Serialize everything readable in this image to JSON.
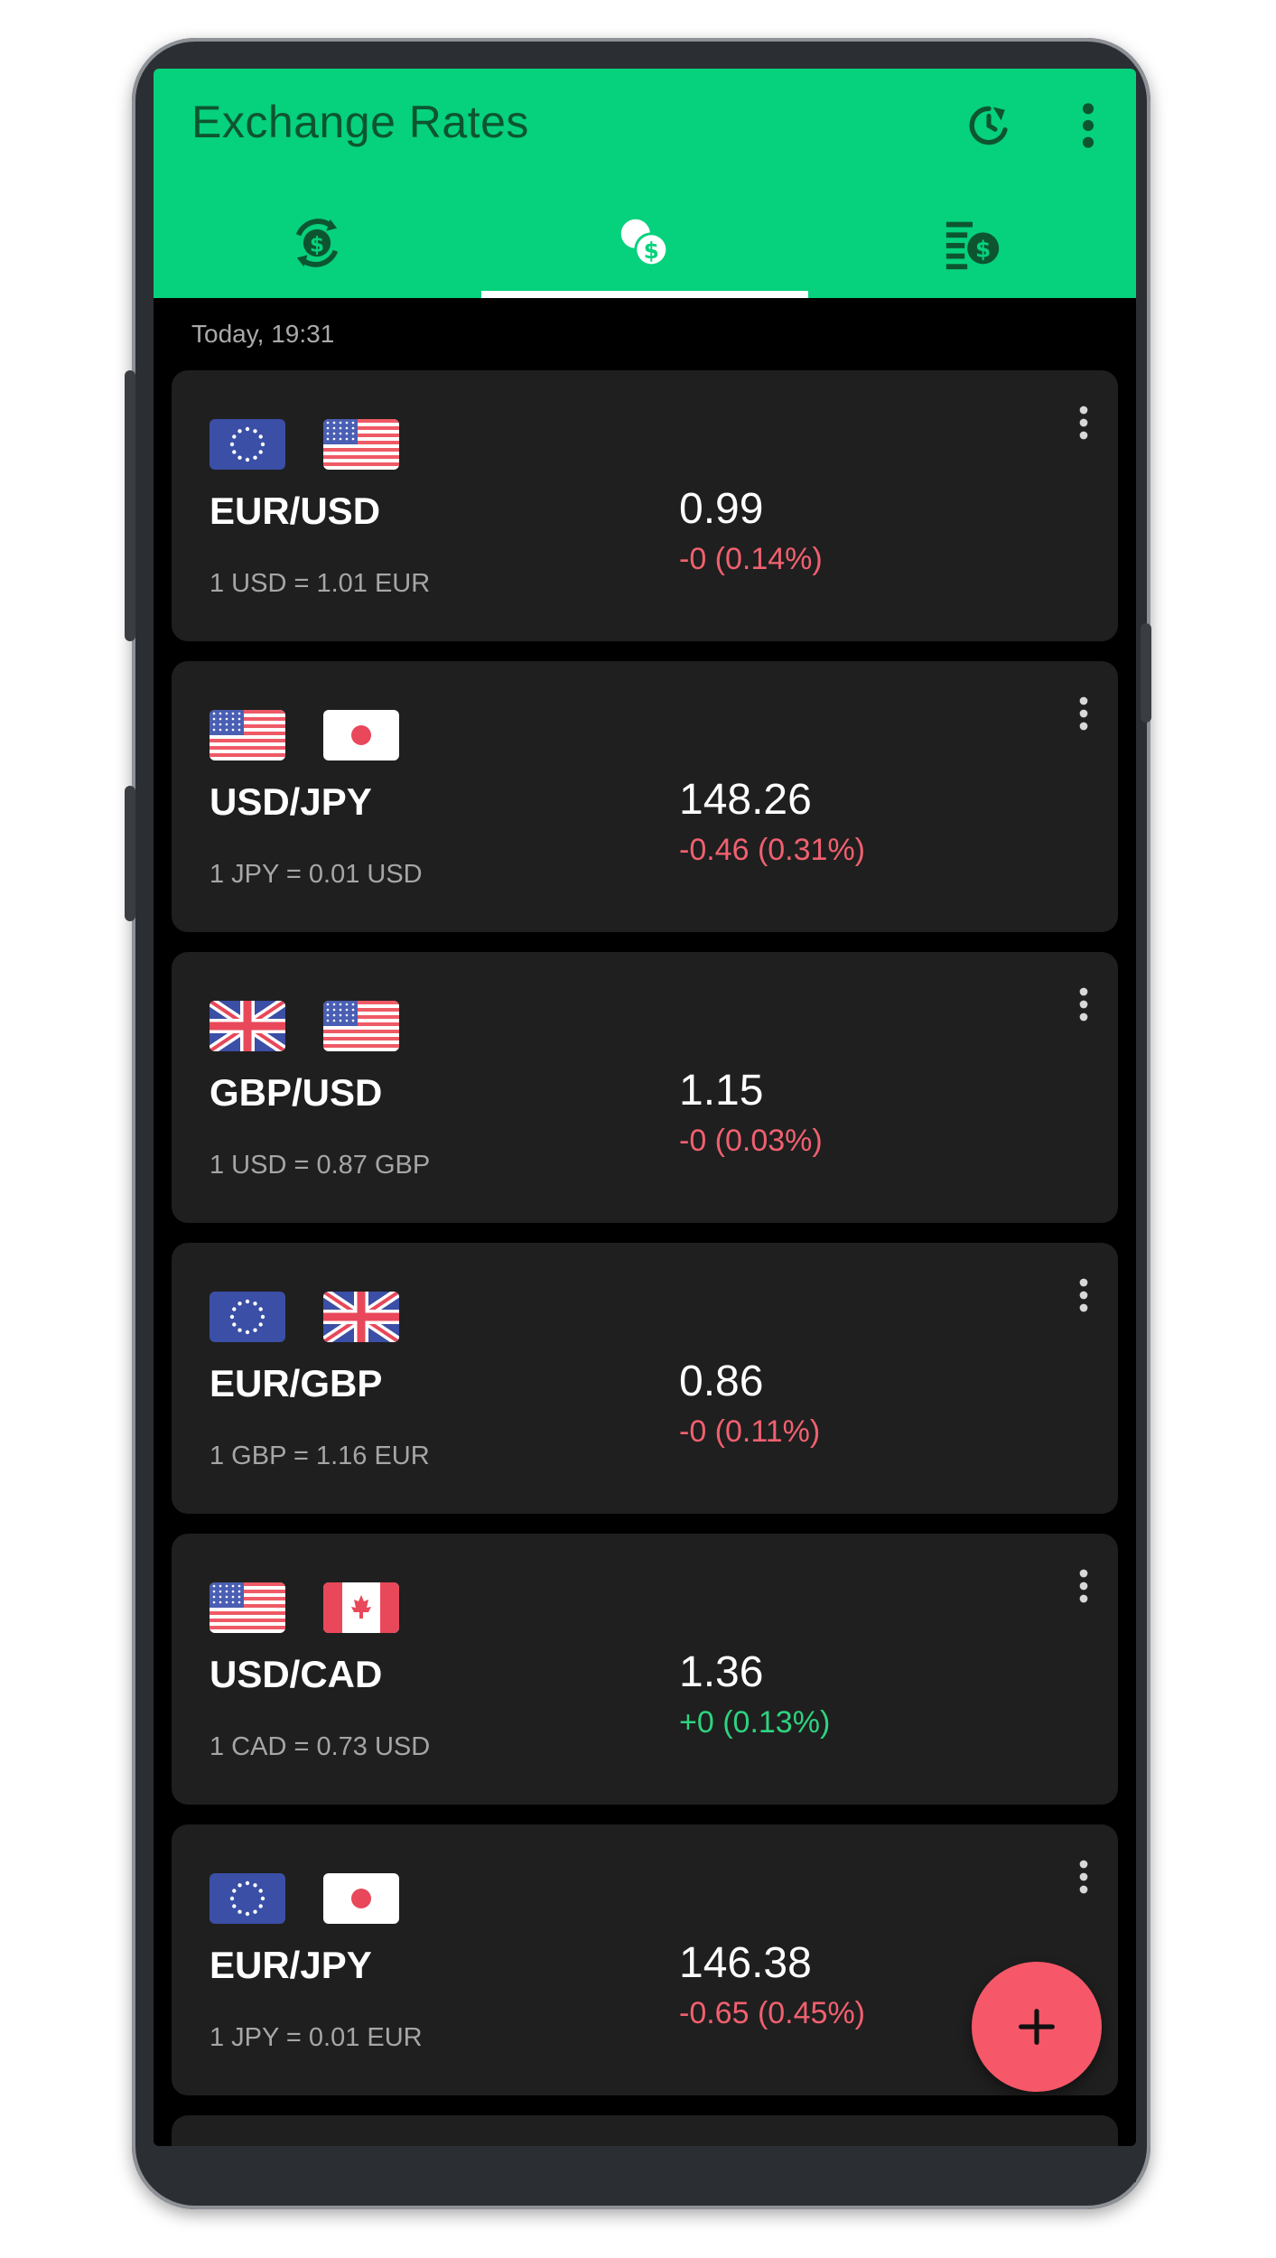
{
  "app": {
    "title": "Exchange Rates",
    "accent_color": "#06d17c",
    "negative_color": "#f1606f",
    "positive_color": "#2ed37f",
    "fab_color": "#f65869"
  },
  "toolbar": {
    "refresh_icon": "refresh-icon",
    "menu_icon": "more-vert-icon"
  },
  "tabs": [
    {
      "icon": "currency-exchange-icon",
      "active": false
    },
    {
      "icon": "coins-icon",
      "active": true
    },
    {
      "icon": "price-list-icon",
      "active": false
    }
  ],
  "timestamp": "Today, 19:31",
  "rates": [
    {
      "pair": "EUR/USD",
      "inverse": "1 USD = 1.01 EUR",
      "rate": "0.99",
      "change": "-0 (0.14%)",
      "direction": "neg",
      "flags": [
        "eu",
        "us"
      ]
    },
    {
      "pair": "USD/JPY",
      "inverse": "1 JPY = 0.01 USD",
      "rate": "148.26",
      "change": "-0.46 (0.31%)",
      "direction": "neg",
      "flags": [
        "us",
        "jp"
      ]
    },
    {
      "pair": "GBP/USD",
      "inverse": "1 USD = 0.87 GBP",
      "rate": "1.15",
      "change": "-0 (0.03%)",
      "direction": "neg",
      "flags": [
        "gb",
        "us"
      ]
    },
    {
      "pair": "EUR/GBP",
      "inverse": "1 GBP = 1.16 EUR",
      "rate": "0.86",
      "change": "-0 (0.11%)",
      "direction": "neg",
      "flags": [
        "eu",
        "gb"
      ]
    },
    {
      "pair": "USD/CAD",
      "inverse": "1 CAD = 0.73 USD",
      "rate": "1.36",
      "change": "+0 (0.13%)",
      "direction": "pos",
      "flags": [
        "us",
        "ca"
      ]
    },
    {
      "pair": "EUR/JPY",
      "inverse": "1 JPY = 0.01 EUR",
      "rate": "146.38",
      "change": "-0.65 (0.45%)",
      "direction": "neg",
      "flags": [
        "eu",
        "jp"
      ]
    }
  ],
  "fab": {
    "icon": "add-icon"
  }
}
